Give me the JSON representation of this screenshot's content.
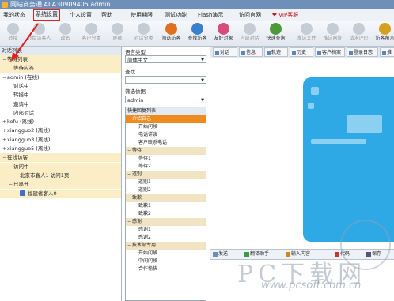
{
  "window": {
    "title": "网站商务通 ALA30909405 admin"
  },
  "menu": {
    "items": [
      "我的状态",
      "系统设置",
      "个人设置",
      "帮助",
      "使用期限",
      "测试功能",
      "Flash演示",
      "访问官网"
    ],
    "active_index": 1,
    "vip_label": "VIP客服"
  },
  "toolbar": {
    "buttons": [
      {
        "label": "转接",
        "icon": "transfer-icon",
        "color": "#9aa6b4",
        "enabled": false
      },
      {
        "label": "转给访客人",
        "icon": "transfer-visitor-icon",
        "color": "#9aa6b4",
        "enabled": false
      },
      {
        "label": "改名",
        "icon": "rename-icon",
        "color": "#9aa6b4",
        "enabled": false
      },
      {
        "label": "客户分类",
        "icon": "category-icon",
        "color": "#9aa6b4",
        "enabled": false
      },
      {
        "label": "屏蔽",
        "icon": "block-icon",
        "color": "#9aa6b4",
        "enabled": false
      },
      {
        "label": "对话分类",
        "icon": "chat-category-icon",
        "color": "#9aa6b4",
        "enabled": false
      },
      {
        "label": "筛选访客",
        "icon": "filter-visitor-icon",
        "color": "#e07020",
        "enabled": true
      },
      {
        "label": "查找访客",
        "icon": "find-visitor-icon",
        "color": "#3a7fd0",
        "enabled": true
      },
      {
        "label": "友好对象",
        "icon": "friend-icon",
        "color": "#d94b7a",
        "enabled": true
      },
      {
        "label": "内部对话",
        "icon": "internal-chat-icon",
        "color": "#9aa6b4",
        "enabled": false
      },
      {
        "label": "快速查询",
        "icon": "quick-search-icon",
        "color": "#4c9a3a",
        "enabled": true
      },
      {
        "label": "发送文件",
        "icon": "send-file-icon",
        "color": "#9aa6b4",
        "enabled": false
      },
      {
        "label": "推送网址",
        "icon": "push-url-icon",
        "color": "#9aa6b4",
        "enabled": false
      },
      {
        "label": "请求评价",
        "icon": "request-review-icon",
        "color": "#9aa6b4",
        "enabled": false
      },
      {
        "label": "访客留言",
        "icon": "visitor-message-icon",
        "color": "#d5a021",
        "enabled": true
      }
    ]
  },
  "left_panel": {
    "header": "对话列表",
    "rows": [
      {
        "text": "等待列表",
        "level": 0,
        "toggle": "−",
        "highlight": true
      },
      {
        "text": "等待应答",
        "level": 1,
        "toggle": "",
        "highlight": true
      },
      {
        "text": "admin (在线)",
        "level": 0,
        "toggle": "−",
        "highlight": false
      },
      {
        "text": "对话中",
        "level": 1,
        "toggle": "",
        "highlight": false
      },
      {
        "text": "转接中",
        "level": 1,
        "toggle": "",
        "highlight": false
      },
      {
        "text": "邀请中",
        "level": 1,
        "toggle": "",
        "highlight": false
      },
      {
        "text": "内部对话",
        "level": 1,
        "toggle": "",
        "highlight": false
      },
      {
        "text": "kefu (离线)",
        "level": 0,
        "toggle": "+",
        "highlight": false
      },
      {
        "text": "xiangguo2 (离线)",
        "level": 0,
        "toggle": "+",
        "highlight": false
      },
      {
        "text": "xiangguo3 (离线)",
        "level": 0,
        "toggle": "+",
        "highlight": false
      },
      {
        "text": "xiangguo5 (离线)",
        "level": 0,
        "toggle": "+",
        "highlight": false
      },
      {
        "text": "在线访客",
        "level": 0,
        "toggle": "−",
        "highlight": true
      },
      {
        "text": "访问中",
        "level": 1,
        "toggle": "−",
        "highlight": true
      },
      {
        "text": "北京市客人1 访问1页",
        "level": 2,
        "toggle": "",
        "highlight": true
      },
      {
        "text": "已离开",
        "level": 1,
        "toggle": "−",
        "highlight": true
      },
      {
        "text": "福建省客人0",
        "level": 2,
        "toggle": "",
        "highlight": true,
        "icon": "visitor-icon"
      }
    ]
  },
  "mid_panel": {
    "lang_label": "语言类型",
    "lang_value": "简体中文",
    "search_label": "查找",
    "search_value": "",
    "filter_label": "筛选依据",
    "filter_value": "admin",
    "list_header": "快捷回复列表",
    "list": [
      {
        "type": "cat",
        "text": "介绍自己",
        "mark": "−",
        "selected": true
      },
      {
        "type": "item",
        "text": "开始问候"
      },
      {
        "type": "item",
        "text": "电话详谈"
      },
      {
        "type": "item",
        "text": "客户联系电话"
      },
      {
        "type": "cat",
        "text": "等待",
        "mark": "−",
        "selected": false
      },
      {
        "type": "item",
        "text": "等待1"
      },
      {
        "type": "item",
        "text": "等待2"
      },
      {
        "type": "cat",
        "text": "道别",
        "mark": "−",
        "selected": false
      },
      {
        "type": "item",
        "text": "道别1"
      },
      {
        "type": "item",
        "text": "道别2"
      },
      {
        "type": "cat",
        "text": "致歉",
        "mark": "−",
        "selected": false
      },
      {
        "type": "item",
        "text": "致歉1"
      },
      {
        "type": "item",
        "text": "致歉2"
      },
      {
        "type": "cat",
        "text": "感谢",
        "mark": "−",
        "selected": false
      },
      {
        "type": "item",
        "text": "感谢1"
      },
      {
        "type": "item",
        "text": "感谢2"
      },
      {
        "type": "cat",
        "text": "技术部专用",
        "mark": "−",
        "selected": false
      },
      {
        "type": "item",
        "text": "开始问候"
      },
      {
        "type": "item",
        "text": "中间问候"
      },
      {
        "type": "item",
        "text": "合作愉快"
      }
    ]
  },
  "right_panel": {
    "tabs": [
      "对话",
      "信息",
      "轨迹",
      "历史",
      "客户档案",
      "登录日志",
      "推"
    ],
    "sendbar": [
      "发送",
      "翻译助手",
      "输入内容",
      "代码",
      "保存"
    ]
  },
  "watermark": {
    "text": "PC下载网",
    "url": "www.pcsoft.com.cn"
  }
}
